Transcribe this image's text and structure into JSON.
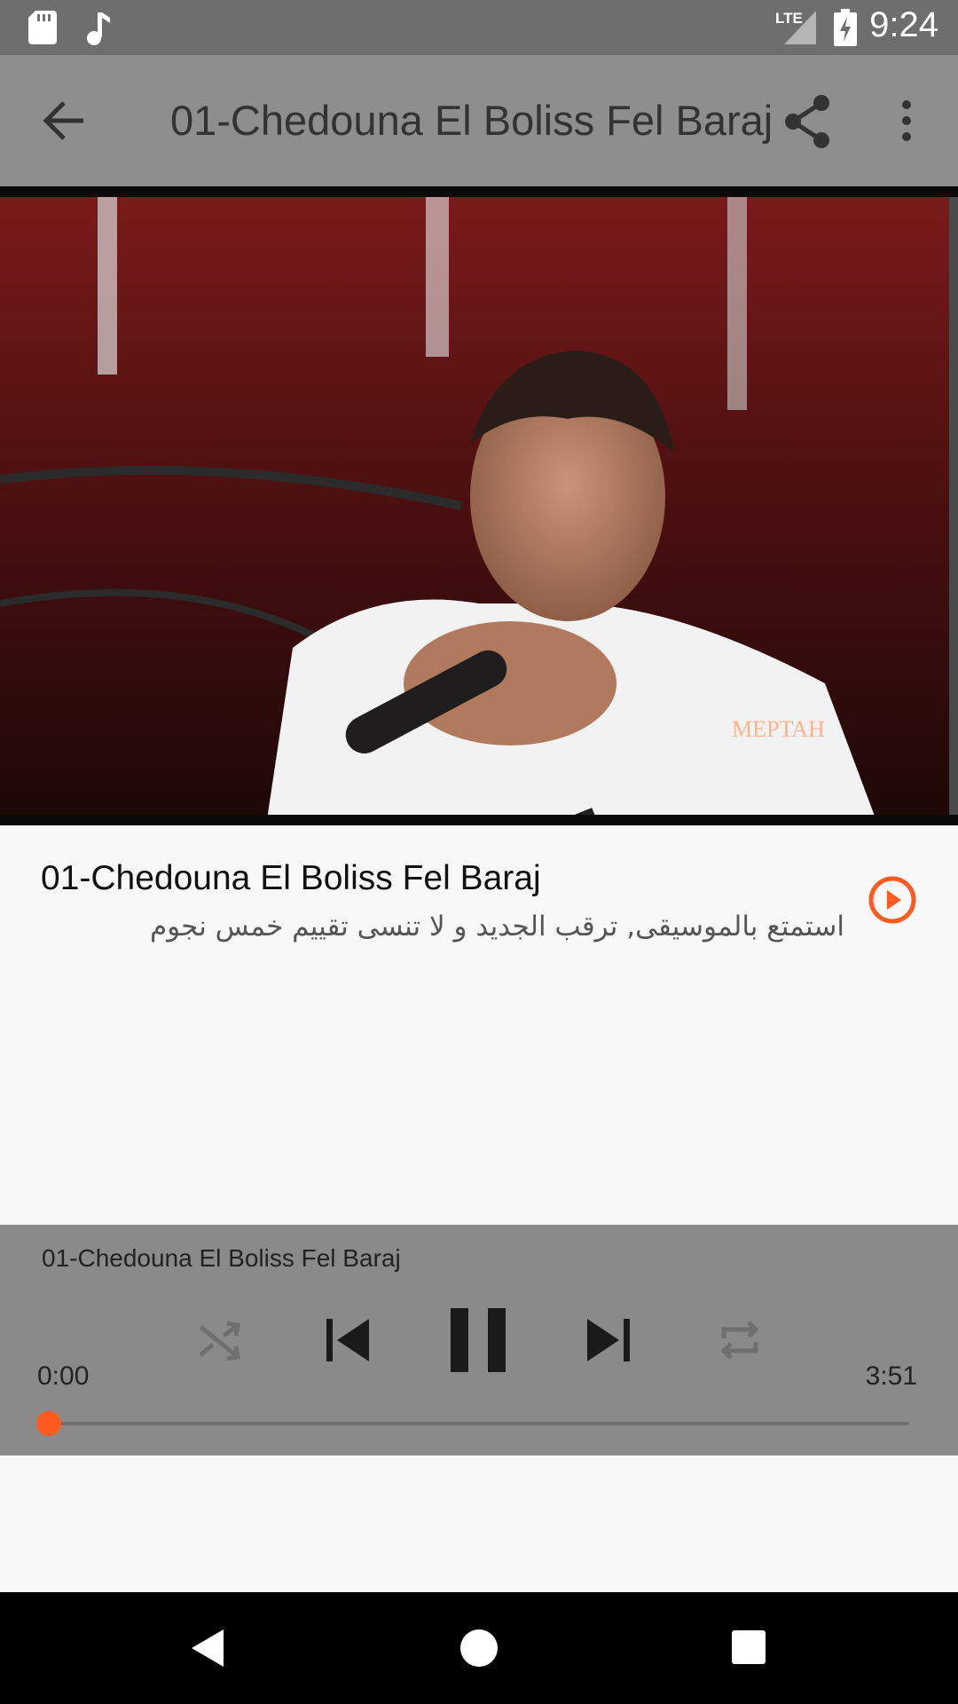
{
  "status_bar": {
    "time": "9:24",
    "network": "LTE",
    "icons": [
      "sd-card-icon",
      "music-note-icon",
      "signal-icon",
      "battery-charging-icon"
    ]
  },
  "app_bar": {
    "title": "01-Chedouna El Boliss Fel Baraj",
    "icons": [
      "back-arrow-icon",
      "share-icon",
      "more-vert-icon"
    ]
  },
  "video": {
    "watermark_text": "MEPTAH"
  },
  "track": {
    "title": "01-Chedouna El Boliss Fel Baraj",
    "subtitle": "استمتع بالموسيقى, ترقب الجديد و لا تنسى تقييم خمس نجوم",
    "play_icon": "play-circle-icon"
  },
  "player": {
    "now_playing_title": "01-Chedouna El Boliss Fel Baraj",
    "current_time": "0:00",
    "total_time": "3:51",
    "progress_fraction": 0.0,
    "controls": [
      "shuffle-icon",
      "skip-previous-icon",
      "pause-icon",
      "skip-next-icon",
      "repeat-icon"
    ]
  },
  "colors": {
    "accent": "#ff5a1f",
    "status_bar": "#6e6e6e",
    "app_bar": "#8e8e8e",
    "player_bg": "#8a8a8a",
    "page_bg": "#f8f8f8"
  }
}
